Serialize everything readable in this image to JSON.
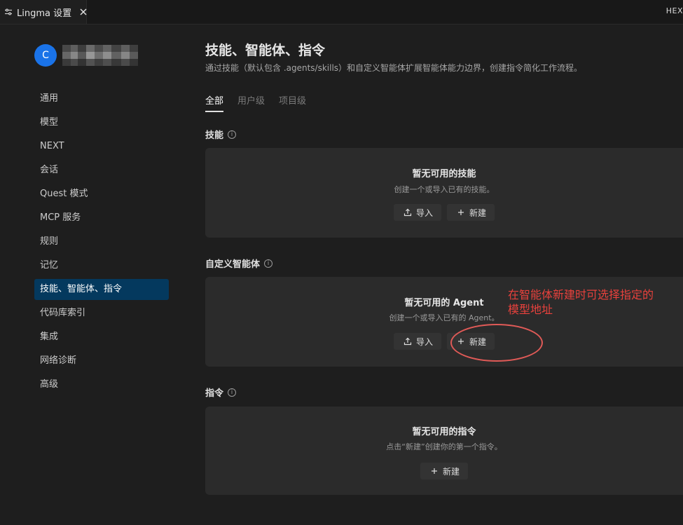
{
  "window": {
    "tab_title": "Lingma 设置",
    "right_label": "HEX"
  },
  "profile": {
    "initial": "C"
  },
  "sidebar": {
    "items": [
      {
        "label": "通用"
      },
      {
        "label": "模型"
      },
      {
        "label": "NEXT"
      },
      {
        "label": "会话"
      },
      {
        "label": "Quest 模式"
      },
      {
        "label": "MCP 服务"
      },
      {
        "label": "规则"
      },
      {
        "label": "记忆"
      },
      {
        "label": "技能、智能体、指令"
      },
      {
        "label": "代码库索引"
      },
      {
        "label": "集成"
      },
      {
        "label": "网络诊断"
      },
      {
        "label": "高级"
      }
    ],
    "active_index": 8
  },
  "main": {
    "title": "技能、智能体、指令",
    "description": "通过技能（默认包含 .agents/skills）和自定义智能体扩展智能体能力边界，创建指令简化工作流程。",
    "tabs": [
      {
        "label": "全部"
      },
      {
        "label": "用户级"
      },
      {
        "label": "项目级"
      }
    ],
    "sections": {
      "skills": {
        "title": "技能",
        "empty_title": "暂无可用的技能",
        "empty_desc": "创建一个或导入已有的技能。",
        "import_label": "导入",
        "new_label": "新建"
      },
      "agents": {
        "title": "自定义智能体",
        "empty_title": "暂无可用的 Agent",
        "empty_desc": "创建一个或导入已有的 Agent。",
        "import_label": "导入",
        "new_label": "新建"
      },
      "commands": {
        "title": "指令",
        "empty_title": "暂无可用的指令",
        "empty_desc": "点击“新建”创建你的第一个指令。",
        "new_label": "新建"
      }
    }
  },
  "annotation": {
    "line1": "在智能体新建时可选择指定的",
    "line2": "模型地址",
    "color": "#e8413c"
  },
  "colors": {
    "accent_avatar": "#1a73e8",
    "active_nav": "#04395e",
    "panel_bg": "#2b2b2b"
  }
}
